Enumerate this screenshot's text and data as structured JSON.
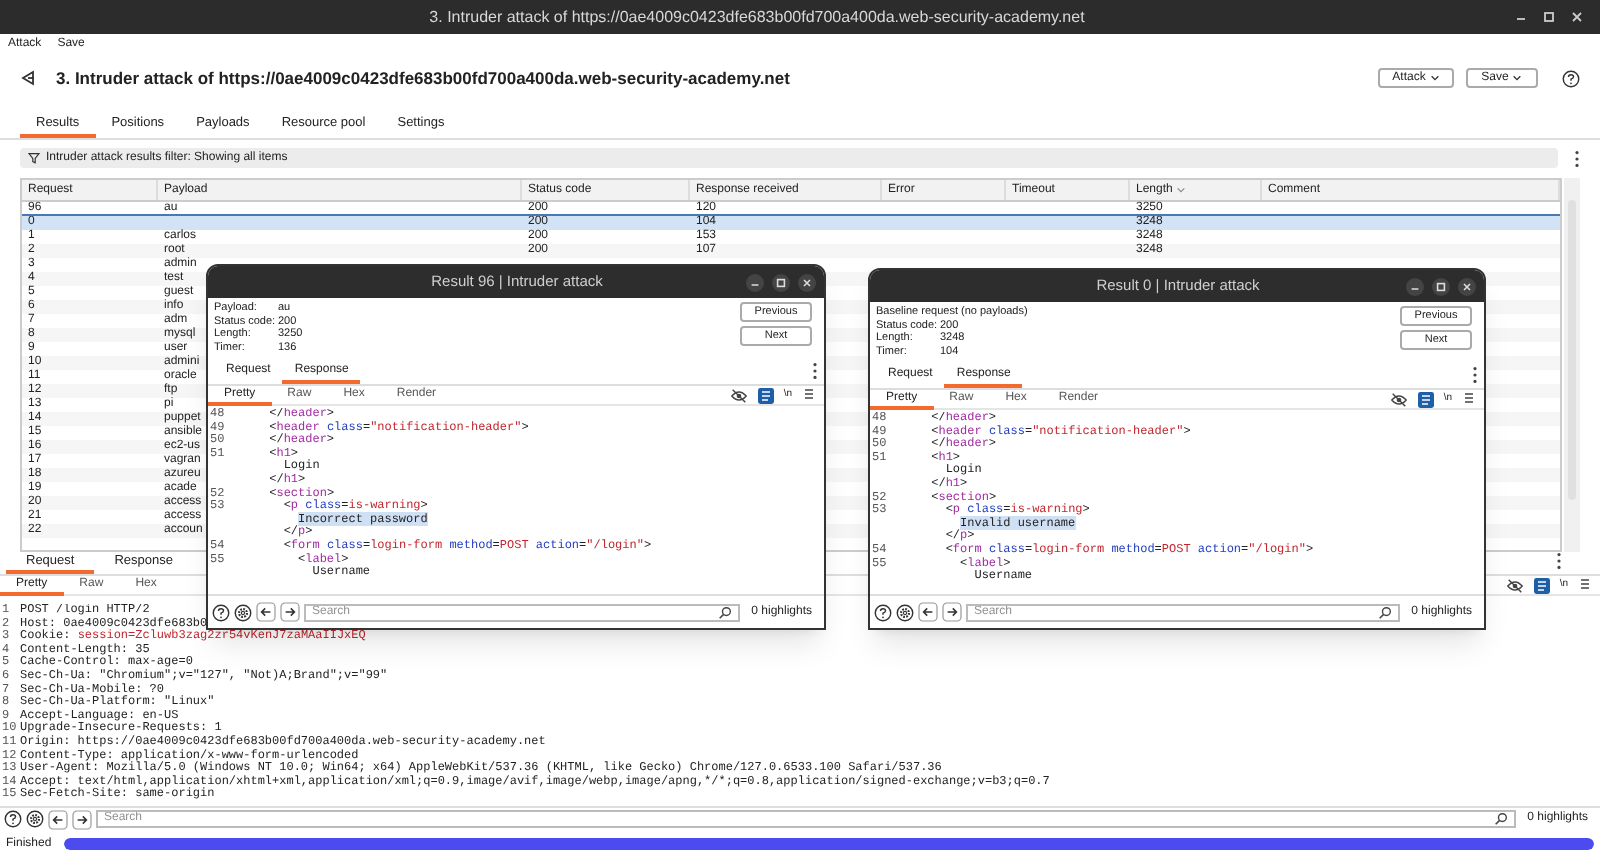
{
  "window": {
    "title": "3. Intruder attack of https://0ae4009c0423dfe683b00fd700a400da.web-security-academy.net"
  },
  "menu": [
    "Attack",
    "Save"
  ],
  "header": {
    "title": "3. Intruder attack of https://0ae4009c0423dfe683b00fd700a400da.web-security-academy.net",
    "buttons": [
      "Attack",
      "Save"
    ]
  },
  "tabs": [
    {
      "label": "Results",
      "selected": true
    },
    {
      "label": "Positions",
      "selected": false
    },
    {
      "label": "Payloads",
      "selected": false
    },
    {
      "label": "Resource pool",
      "selected": false
    },
    {
      "label": "Settings",
      "selected": false
    }
  ],
  "filter": {
    "text": "Intruder attack results filter: Showing all items"
  },
  "table": {
    "columns": [
      {
        "label": "Request",
        "sorted": false
      },
      {
        "label": "Payload",
        "sorted": false
      },
      {
        "label": "Status code",
        "sorted": false
      },
      {
        "label": "Response received",
        "sorted": false
      },
      {
        "label": "Error",
        "sorted": false
      },
      {
        "label": "Timeout",
        "sorted": false
      },
      {
        "label": "Length",
        "sorted": true
      },
      {
        "label": "Comment",
        "sorted": false
      }
    ],
    "rows": [
      {
        "request": "96",
        "payload": "au",
        "status_code": "200",
        "response_received": "120",
        "length": "3250",
        "selected": false
      },
      {
        "request": "0",
        "status_code": "200",
        "response_received": "104",
        "length": "3248",
        "selected": true
      },
      {
        "request": "1",
        "payload": "carlos",
        "status_code": "200",
        "response_received": "153",
        "length": "3248",
        "selected": false
      },
      {
        "request": "2",
        "payload": "root",
        "status_code": "200",
        "response_received": "107",
        "length": "3248",
        "selected": false
      },
      {
        "request": "3",
        "payload": "admin",
        "selected": false
      },
      {
        "request": "4",
        "payload": "test",
        "selected": false
      },
      {
        "request": "5",
        "payload": "guest",
        "selected": false
      },
      {
        "request": "6",
        "payload": "info",
        "selected": false
      },
      {
        "request": "7",
        "payload": "adm",
        "selected": false
      },
      {
        "request": "8",
        "payload": "mysql",
        "selected": false
      },
      {
        "request": "9",
        "payload": "user",
        "selected": false
      },
      {
        "request": "10",
        "payload": "admini",
        "selected": false
      },
      {
        "request": "11",
        "payload": "oracle",
        "selected": false
      },
      {
        "request": "12",
        "payload": "ftp",
        "selected": false
      },
      {
        "request": "13",
        "payload": "pi",
        "selected": false
      },
      {
        "request": "14",
        "payload": "puppet",
        "selected": false
      },
      {
        "request": "15",
        "payload": "ansible",
        "selected": false
      },
      {
        "request": "16",
        "payload": "ec2-us",
        "selected": false
      },
      {
        "request": "17",
        "payload": "vagran",
        "selected": false
      },
      {
        "request": "18",
        "payload": "azureu",
        "selected": false
      },
      {
        "request": "19",
        "payload": "acade",
        "selected": false
      },
      {
        "request": "20",
        "payload": "access",
        "selected": false
      },
      {
        "request": "21",
        "payload": "access",
        "selected": false
      },
      {
        "request": "22",
        "payload": "accoun",
        "selected": false
      }
    ]
  },
  "request_pane": {
    "tabs": [
      {
        "label": "Request",
        "selected": true
      },
      {
        "label": "Response",
        "selected": false
      }
    ],
    "view_tabs": [
      {
        "label": "Pretty",
        "selected": true
      },
      {
        "label": "Raw",
        "selected": false
      },
      {
        "label": "Hex",
        "selected": false
      }
    ],
    "newline_button": "\\n",
    "lines": [
      {
        "number": "1",
        "parts": [
          {
            "kind": "plain",
            "text": "POST /login HTTP/2"
          }
        ]
      },
      {
        "number": "2",
        "parts": [
          {
            "kind": "plain",
            "text": "Host: 0ae4009c0423dfe683b0"
          }
        ]
      },
      {
        "number": "3",
        "parts": [
          {
            "kind": "plain",
            "text": "Cookie:"
          },
          {
            "kind": "cookie",
            "text": " session=Zcluwb3zag2zr54vKenJ7zaMAaIIJxEQ"
          }
        ]
      },
      {
        "number": "4",
        "parts": [
          {
            "kind": "plain",
            "text": "Content-Length: 35"
          }
        ]
      },
      {
        "number": "5",
        "parts": [
          {
            "kind": "plain",
            "text": "Cache-Control: max-age=0"
          }
        ]
      },
      {
        "number": "6",
        "parts": [
          {
            "kind": "plain",
            "text": "Sec-Ch-Ua: \"Chromium\";v=\"127\", \"Not)A;Brand\";v=\"99\""
          }
        ]
      },
      {
        "number": "7",
        "parts": [
          {
            "kind": "plain",
            "text": "Sec-Ch-Ua-Mobile: ?0"
          }
        ]
      },
      {
        "number": "8",
        "parts": [
          {
            "kind": "plain",
            "text": "Sec-Ch-Ua-Platform: \"Linux\""
          }
        ]
      },
      {
        "number": "9",
        "parts": [
          {
            "kind": "plain",
            "text": "Accept-Language: en-US"
          }
        ]
      },
      {
        "number": "10",
        "parts": [
          {
            "kind": "plain",
            "text": "Upgrade-Insecure-Requests: 1"
          }
        ]
      },
      {
        "number": "11",
        "parts": [
          {
            "kind": "plain",
            "text": "Origin: https://0ae4009c0423dfe683b00fd700a400da.web-security-academy.net"
          }
        ]
      },
      {
        "number": "12",
        "parts": [
          {
            "kind": "plain",
            "text": "Content-Type: application/x-www-form-urlencoded"
          }
        ]
      },
      {
        "number": "13",
        "parts": [
          {
            "kind": "plain",
            "text": "User-Agent: Mozilla/5.0 (Windows NT 10.0; Win64; x64) AppleWebKit/537.36 (KHTML, like Gecko) Chrome/127.0.6533.100 Safari/537.36"
          }
        ]
      },
      {
        "number": "14",
        "parts": [
          {
            "kind": "plain",
            "text": "Accept: text/html,application/xhtml+xml,application/xml;q=0.9,image/avif,image/webp,image/apng,*/*;q=0.8,application/signed-exchange;v=b3;q=0.7"
          }
        ]
      },
      {
        "number": "15",
        "parts": [
          {
            "kind": "plain",
            "text": "Sec-Fetch-Site: same-origin"
          }
        ]
      }
    ],
    "search": {
      "placeholder": "Search"
    },
    "highlights": "0 highlights"
  },
  "status_bar": {
    "text": "Finished",
    "progress": {
      "level": 1
    }
  },
  "popups": [
    {
      "title": "Result 96 | Intruder attack",
      "info": [
        {
          "label": "Payload:",
          "value": "au"
        },
        {
          "label": "Status code:",
          "value": "200"
        },
        {
          "label": "Length:",
          "value": "3250"
        },
        {
          "label": "Timer:",
          "value": "136"
        }
      ],
      "buttons": [
        "Previous",
        "Next"
      ],
      "tabs": [
        {
          "label": "Request",
          "selected": false
        },
        {
          "label": "Response",
          "selected": true
        }
      ],
      "view_tabs": [
        {
          "label": "Pretty",
          "selected": true
        },
        {
          "label": "Raw",
          "selected": false
        },
        {
          "label": "Hex",
          "selected": false
        },
        {
          "label": "Render",
          "selected": false
        }
      ],
      "newline_button": "\\n",
      "lines": [
        {
          "number": "48",
          "parts": [
            {
              "kind": "plain",
              "text": "      </"
            },
            {
              "kind": "tag",
              "text": "header"
            },
            {
              "kind": "plain",
              "text": ">"
            }
          ]
        },
        {
          "number": "49",
          "parts": [
            {
              "kind": "plain",
              "text": "      <"
            },
            {
              "kind": "tag",
              "text": "header"
            },
            {
              "kind": "attr",
              "text": " class"
            },
            {
              "kind": "plain",
              "text": "="
            },
            {
              "kind": "value",
              "text": "\"notification-header\""
            },
            {
              "kind": "plain",
              "text": ">"
            }
          ]
        },
        {
          "number": "50",
          "parts": [
            {
              "kind": "plain",
              "text": "      </"
            },
            {
              "kind": "tag",
              "text": "header"
            },
            {
              "kind": "plain",
              "text": ">"
            }
          ]
        },
        {
          "number": "51",
          "parts": [
            {
              "kind": "plain",
              "text": "      <"
            },
            {
              "kind": "tag",
              "text": "h1"
            },
            {
              "kind": "plain",
              "text": ">"
            }
          ]
        },
        {
          "parts": [
            {
              "kind": "plain",
              "text": "        Login"
            }
          ]
        },
        {
          "parts": [
            {
              "kind": "plain",
              "text": "      </"
            },
            {
              "kind": "tag",
              "text": "h1"
            },
            {
              "kind": "plain",
              "text": ">"
            }
          ]
        },
        {
          "number": "52",
          "parts": [
            {
              "kind": "plain",
              "text": "      <"
            },
            {
              "kind": "tag",
              "text": "section"
            },
            {
              "kind": "plain",
              "text": ">"
            }
          ]
        },
        {
          "number": "53",
          "parts": [
            {
              "kind": "plain",
              "text": "        <"
            },
            {
              "kind": "tag",
              "text": "p"
            },
            {
              "kind": "attr",
              "text": " class"
            },
            {
              "kind": "plain",
              "text": "="
            },
            {
              "kind": "value",
              "text": "is-warning"
            },
            {
              "kind": "plain",
              "text": ">"
            }
          ]
        },
        {
          "parts": [
            {
              "kind": "mark",
              "text": "          Incorrect password"
            }
          ]
        },
        {
          "parts": [
            {
              "kind": "plain",
              "text": "        </"
            },
            {
              "kind": "tag",
              "text": "p"
            },
            {
              "kind": "plain",
              "text": ">"
            }
          ]
        },
        {
          "number": "54",
          "parts": [
            {
              "kind": "plain",
              "text": "        <"
            },
            {
              "kind": "tag",
              "text": "form"
            },
            {
              "kind": "attr",
              "text": " class"
            },
            {
              "kind": "plain",
              "text": "="
            },
            {
              "kind": "value",
              "text": "login-form"
            },
            {
              "kind": "attr",
              "text": " method"
            },
            {
              "kind": "plain",
              "text": "="
            },
            {
              "kind": "value",
              "text": "POST"
            },
            {
              "kind": "attr",
              "text": " action"
            },
            {
              "kind": "plain",
              "text": "="
            },
            {
              "kind": "value",
              "text": "\"/login\""
            },
            {
              "kind": "plain",
              "text": ">"
            }
          ]
        },
        {
          "number": "55",
          "parts": [
            {
              "kind": "plain",
              "text": "          <"
            },
            {
              "kind": "tag",
              "text": "label"
            },
            {
              "kind": "plain",
              "text": ">"
            }
          ]
        },
        {
          "parts": [
            {
              "kind": "plain",
              "text": "            Username"
            }
          ]
        }
      ],
      "search": {
        "placeholder": "Search"
      },
      "highlights": "0 highlights"
    },
    {
      "title": "Result 0 | Intruder attack",
      "info": [
        {
          "label": "Baseline request (no payloads)"
        },
        {
          "label": "Status code:",
          "value": "200"
        },
        {
          "label": "Length:",
          "value": "3248"
        },
        {
          "label": "Timer:",
          "value": "104"
        }
      ],
      "buttons": [
        "Previous",
        "Next"
      ],
      "tabs": [
        {
          "label": "Request",
          "selected": false
        },
        {
          "label": "Response",
          "selected": true
        }
      ],
      "view_tabs": [
        {
          "label": "Pretty",
          "selected": true
        },
        {
          "label": "Raw",
          "selected": false
        },
        {
          "label": "Hex",
          "selected": false
        },
        {
          "label": "Render",
          "selected": false
        }
      ],
      "newline_button": "\\n",
      "lines": [
        {
          "number": "48",
          "parts": [
            {
              "kind": "plain",
              "text": "      </"
            },
            {
              "kind": "tag",
              "text": "header"
            },
            {
              "kind": "plain",
              "text": ">"
            }
          ]
        },
        {
          "number": "49",
          "parts": [
            {
              "kind": "plain",
              "text": "      <"
            },
            {
              "kind": "tag",
              "text": "header"
            },
            {
              "kind": "attr",
              "text": " class"
            },
            {
              "kind": "plain",
              "text": "="
            },
            {
              "kind": "value",
              "text": "\"notification-header\""
            },
            {
              "kind": "plain",
              "text": ">"
            }
          ]
        },
        {
          "number": "50",
          "parts": [
            {
              "kind": "plain",
              "text": "      </"
            },
            {
              "kind": "tag",
              "text": "header"
            },
            {
              "kind": "plain",
              "text": ">"
            }
          ]
        },
        {
          "number": "51",
          "parts": [
            {
              "kind": "plain",
              "text": "      <"
            },
            {
              "kind": "tag",
              "text": "h1"
            },
            {
              "kind": "plain",
              "text": ">"
            }
          ]
        },
        {
          "parts": [
            {
              "kind": "plain",
              "text": "        Login"
            }
          ]
        },
        {
          "parts": [
            {
              "kind": "plain",
              "text": "      </"
            },
            {
              "kind": "tag",
              "text": "h1"
            },
            {
              "kind": "plain",
              "text": ">"
            }
          ]
        },
        {
          "number": "52",
          "parts": [
            {
              "kind": "plain",
              "text": "      <"
            },
            {
              "kind": "tag",
              "text": "section"
            },
            {
              "kind": "plain",
              "text": ">"
            }
          ]
        },
        {
          "number": "53",
          "parts": [
            {
              "kind": "plain",
              "text": "        <"
            },
            {
              "kind": "tag",
              "text": "p"
            },
            {
              "kind": "attr",
              "text": " class"
            },
            {
              "kind": "plain",
              "text": "="
            },
            {
              "kind": "value",
              "text": "is-warning"
            },
            {
              "kind": "plain",
              "text": ">"
            }
          ]
        },
        {
          "parts": [
            {
              "kind": "mark",
              "text": "          Invalid username"
            }
          ]
        },
        {
          "parts": [
            {
              "kind": "plain",
              "text": "        </"
            },
            {
              "kind": "tag",
              "text": "p"
            },
            {
              "kind": "plain",
              "text": ">"
            }
          ]
        },
        {
          "number": "54",
          "parts": [
            {
              "kind": "plain",
              "text": "        <"
            },
            {
              "kind": "tag",
              "text": "form"
            },
            {
              "kind": "attr",
              "text": " class"
            },
            {
              "kind": "plain",
              "text": "="
            },
            {
              "kind": "value",
              "text": "login-form"
            },
            {
              "kind": "attr",
              "text": " method"
            },
            {
              "kind": "plain",
              "text": "="
            },
            {
              "kind": "value",
              "text": "POST"
            },
            {
              "kind": "attr",
              "text": " action"
            },
            {
              "kind": "plain",
              "text": "="
            },
            {
              "kind": "value",
              "text": "\"/login\""
            },
            {
              "kind": "plain",
              "text": ">"
            }
          ]
        },
        {
          "number": "55",
          "parts": [
            {
              "kind": "plain",
              "text": "          <"
            },
            {
              "kind": "tag",
              "text": "label"
            },
            {
              "kind": "plain",
              "text": ">"
            }
          ]
        },
        {
          "parts": [
            {
              "kind": "plain",
              "text": "            Username"
            }
          ]
        }
      ],
      "search": {
        "placeholder": "Search"
      },
      "highlights": "0 highlights"
    }
  ]
}
